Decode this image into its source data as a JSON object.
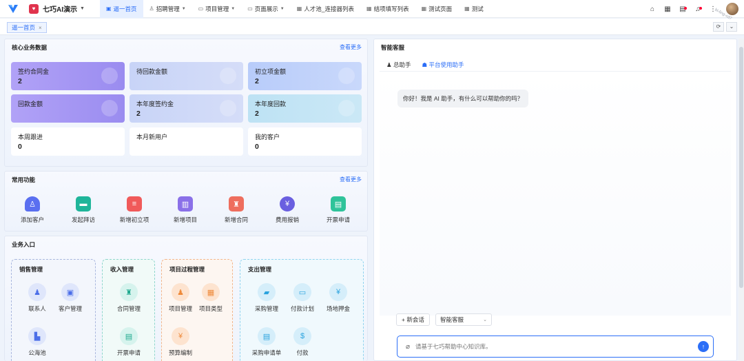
{
  "header": {
    "app_name": "七巧AI演示",
    "app_badge": "♥",
    "nav": [
      {
        "icon": "▣",
        "label": "逼一首页",
        "active": true,
        "dropdown": false
      },
      {
        "icon": "♙",
        "label": "招聘管理",
        "dropdown": true
      },
      {
        "icon": "▭",
        "label": "项目管理",
        "dropdown": true
      },
      {
        "icon": "▭",
        "label": "页面展示",
        "dropdown": true
      },
      {
        "icon": "▦",
        "label": "人才池_连接器列表",
        "dropdown": false
      },
      {
        "icon": "▦",
        "label": "结项填写列表",
        "dropdown": false
      },
      {
        "icon": "▦",
        "label": "测试页面",
        "dropdown": false
      },
      {
        "icon": "▦",
        "label": "测试",
        "dropdown": false
      }
    ],
    "icons": [
      "home-icon",
      "apps-icon",
      "tasks-icon",
      "bell-icon",
      "more-icon"
    ]
  },
  "tabs": {
    "current": "逼一首页",
    "close": "×"
  },
  "core": {
    "title": "核心业务数据",
    "more": "查看更多",
    "cards": [
      {
        "label": "签约合同金",
        "value": "2"
      },
      {
        "label": "待回款金额",
        "value": ""
      },
      {
        "label": "初立项金额",
        "value": "2"
      },
      {
        "label": "回款金额",
        "value": ""
      },
      {
        "label": "本年度签约金",
        "value": "2"
      },
      {
        "label": "本年度回款",
        "value": "2"
      },
      {
        "label": "本周跟进",
        "value": "0"
      },
      {
        "label": "本月新用户",
        "value": ""
      },
      {
        "label": "我的客户",
        "value": "0"
      }
    ]
  },
  "functions": {
    "title": "常用功能",
    "more": "查看更多",
    "items": [
      {
        "label": "添加客户",
        "icon": "person-add-icon"
      },
      {
        "label": "发起拜访",
        "icon": "briefcase-icon"
      },
      {
        "label": "新增初立项",
        "icon": "document-icon"
      },
      {
        "label": "新增项目",
        "icon": "book-icon"
      },
      {
        "label": "新增合同",
        "icon": "stamp-icon"
      },
      {
        "label": "费用报销",
        "icon": "yen-coin-icon"
      },
      {
        "label": "开票申请",
        "icon": "invoice-icon"
      }
    ]
  },
  "business": {
    "title": "业务入口",
    "groups": [
      {
        "title": "销售管理",
        "items": [
          "联系人",
          "客户管理",
          "公海池"
        ]
      },
      {
        "title": "收入管理",
        "items": [
          "合同管理",
          "开票申请"
        ]
      },
      {
        "title": "项目过程管理",
        "items": [
          "项目管理",
          "项目类型",
          "预算编制"
        ]
      },
      {
        "title": "支出管理",
        "items": [
          "采购管理",
          "付款计划",
          "场地押金",
          "采购申请单",
          "付款"
        ]
      }
    ]
  },
  "chat": {
    "title": "智能客服",
    "tabs": [
      "总助手",
      "平台使用助手"
    ],
    "active_tab": 1,
    "greeting": "你好！我是 AI 助手，有什么可以帮助你的吗？",
    "new_session": "+ 新会话",
    "mode": "智能客服",
    "input_placeholder": "请基于七巧帮助中心知识库。",
    "input_value": ""
  },
  "watermark": "bi-ling-cd7"
}
